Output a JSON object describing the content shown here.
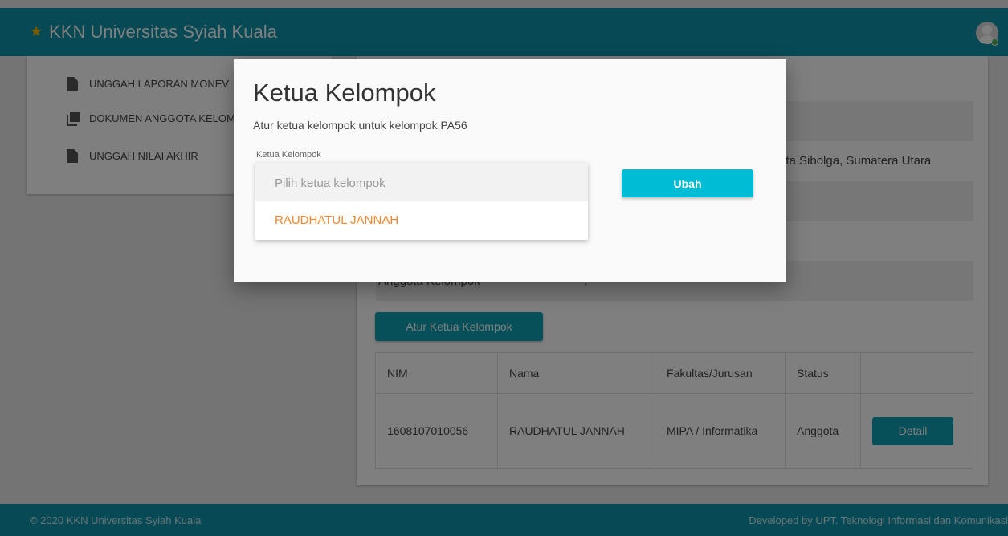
{
  "app": {
    "title": "KKN Universitas Syiah Kuala"
  },
  "sidebar": {
    "items": [
      {
        "label": "UNGGAH LAPORAN MONEV"
      },
      {
        "label": "DOKUMEN ANGGOTA KELOMPOK"
      },
      {
        "label": "UNGGAH NILAI AKHIR"
      }
    ]
  },
  "main": {
    "location_text": "Kota Sibolga, Sumatera Utara",
    "anggota_label": "Anggota Kelompok",
    "anggota_sep": ":",
    "atur_button": "Atur Ketua Kelompok",
    "table": {
      "headers": [
        "NIM",
        "Nama",
        "Fakultas/Jurusan",
        "Status",
        ""
      ],
      "rows": [
        {
          "nim": "1608107010056",
          "nama": "RAUDHATUL JANNAH",
          "fakultas": "MIPA / Informatika",
          "status": "Anggota",
          "action": "Detail"
        }
      ]
    }
  },
  "modal": {
    "title": "Ketua Kelompok",
    "subtitle": "Atur ketua kelompok untuk kelompok PA56",
    "field_label": "Ketua Kelompok",
    "placeholder": "Pilih ketua kelompok",
    "options": [
      "RAUDHATUL JANNAH"
    ],
    "submit": "Ubah"
  },
  "footer": {
    "left": "© 2020 KKN Universitas Syiah Kuala",
    "right": "Developed by UPT. Teknologi Informasi dan Komunikasi"
  },
  "colors": {
    "primary": "#0e95ab",
    "accent": "#00bcd4",
    "option": "#f0872b",
    "star": "#f4b400"
  }
}
